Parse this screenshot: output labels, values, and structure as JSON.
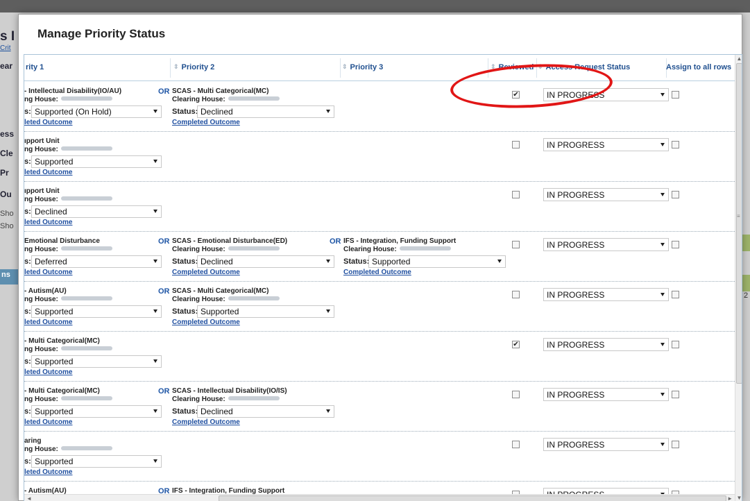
{
  "background": {
    "left_fragments": [
      {
        "text": "s I",
        "style": "big"
      },
      {
        "text": "Crit",
        "style": "link"
      },
      {
        "text": "ear",
        "style": "bold"
      },
      {
        "text": "ess",
        "style": "bold"
      },
      {
        "text": "Cle",
        "style": "bold"
      },
      {
        "text": "Pr",
        "style": "bold"
      },
      {
        "text": "Ou",
        "style": "bold"
      },
      {
        "text": "Sho",
        "style": "small"
      },
      {
        "text": "Sho",
        "style": "small"
      }
    ],
    "band_label": "ns",
    "right_fragment": "2"
  },
  "modal": {
    "title": "Manage Priority Status"
  },
  "columns": {
    "priority1": "rity 1",
    "priority2": "Priority 2",
    "priority3": "Priority 3",
    "reviewed": "Reviewed",
    "access_status": "Access Request Status",
    "assign_all": "Assign to all rows"
  },
  "labels": {
    "or": "OR",
    "clearing_house": "Clearing House:",
    "clearing_house_p1": "ng House:",
    "status": "Status:",
    "status_p1": "s:",
    "completed_outcome": "Completed Outcome",
    "completed_outcome_p1": "leted Outcome"
  },
  "rows": [
    {
      "p1": {
        "name": "- Intellectual Disability(IO/AU)",
        "status": "Supported (On Hold)"
      },
      "p2": {
        "name": "SCAS - Multi Categorical(MC)",
        "status": "Declined"
      },
      "p3": null,
      "reviewed": true,
      "access_status": "IN PROGRESS"
    },
    {
      "p1": {
        "name": "ıpport Unit",
        "status": "Supported"
      },
      "p2": null,
      "p3": null,
      "reviewed": false,
      "access_status": "IN PROGRESS"
    },
    {
      "p1": {
        "name": "ıpport Unit",
        "status": "Declined"
      },
      "p2": null,
      "p3": null,
      "reviewed": false,
      "access_status": "IN PROGRESS"
    },
    {
      "p1": {
        "name": "Emotional Disturbance",
        "status": "Deferred"
      },
      "p2": {
        "name": "SCAS - Emotional Disturbance(ED)",
        "status": "Declined"
      },
      "p3": {
        "name": "IFS - Integration, Funding Support",
        "status": "Supported"
      },
      "reviewed": false,
      "access_status": "IN PROGRESS"
    },
    {
      "p1": {
        "name": "- Autism(AU)",
        "status": "Supported"
      },
      "p2": {
        "name": "SCAS - Multi Categorical(MC)",
        "status": "Supported"
      },
      "p3": null,
      "reviewed": false,
      "access_status": "IN PROGRESS"
    },
    {
      "p1": {
        "name": "- Multi Categorical(MC)",
        "status": "Supported"
      },
      "p2": null,
      "p3": null,
      "reviewed": true,
      "access_status": "IN PROGRESS"
    },
    {
      "p1": {
        "name": "- Multi Categorical(MC)",
        "status": "Supported"
      },
      "p2": {
        "name": "SCAS - Intellectual Disability(IO/IS)",
        "status": "Declined"
      },
      "p3": null,
      "reviewed": false,
      "access_status": "IN PROGRESS"
    },
    {
      "p1": {
        "name": "aring",
        "status": "Supported"
      },
      "p2": null,
      "p3": null,
      "reviewed": false,
      "access_status": "IN PROGRESS"
    },
    {
      "p1": {
        "name": "- Autism(AU)",
        "status": null
      },
      "p2": {
        "name": "IFS - Integration, Funding Support",
        "status": null
      },
      "p3": null,
      "reviewed": false,
      "access_status": "IN PROGRESS"
    }
  ],
  "scrollbar": {
    "grip": "≡",
    "h_grip": "|||"
  },
  "colors": {
    "header_text": "#1f4f8f",
    "link": "#1f4fa0",
    "annotation": "#e11616"
  }
}
